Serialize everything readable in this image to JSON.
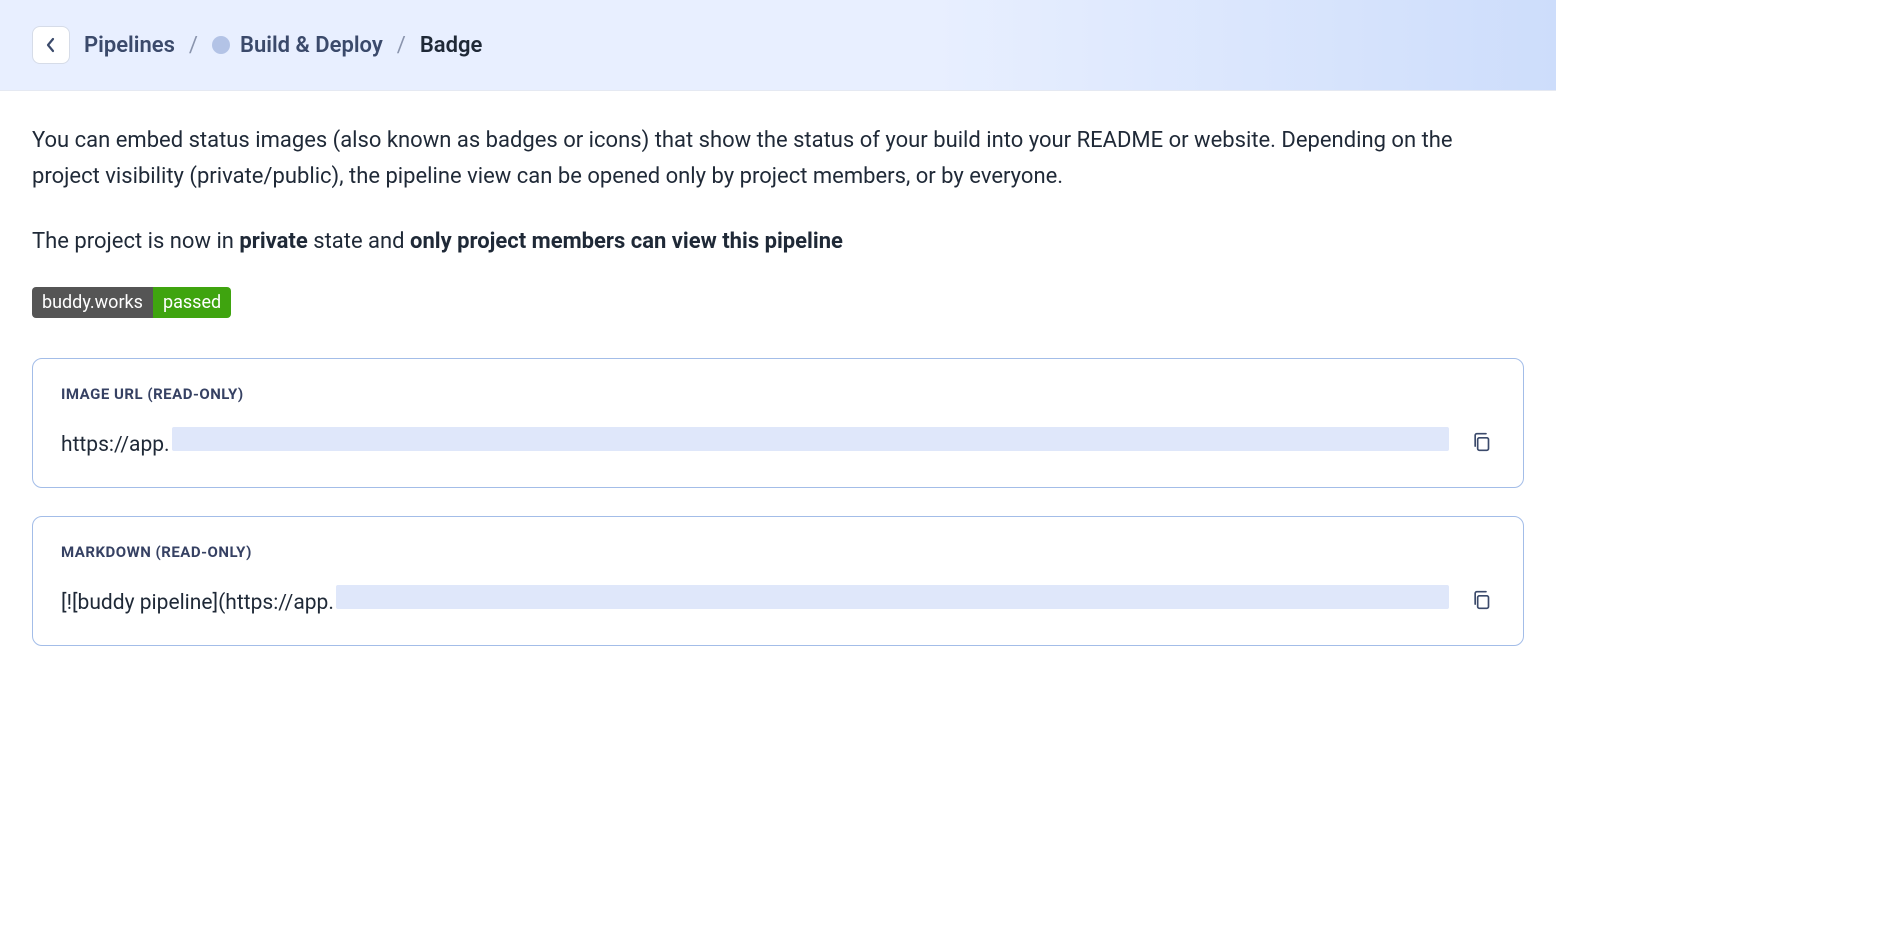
{
  "breadcrumb": {
    "root": "Pipelines",
    "project": "Build & Deploy",
    "page": "Badge"
  },
  "intro": "You can embed status images (also known as badges or icons) that show the status of your build into your README or website. Depending on the project visibility (private/public), the pipeline view can be opened only by project members, or by everyone.",
  "statusLine": {
    "prefix": "The project is now in ",
    "state": "private",
    "mid": " state and ",
    "suffix": "only project members can view this pipeline"
  },
  "badge": {
    "left": "buddy.works",
    "right": "passed"
  },
  "fields": {
    "imageUrl": {
      "label": "IMAGE URL (READ-ONLY)",
      "valuePrefix": "https://app."
    },
    "markdown": {
      "label": "MARKDOWN (READ-ONLY)",
      "valuePrefix": "[![buddy pipeline](https://app."
    }
  }
}
